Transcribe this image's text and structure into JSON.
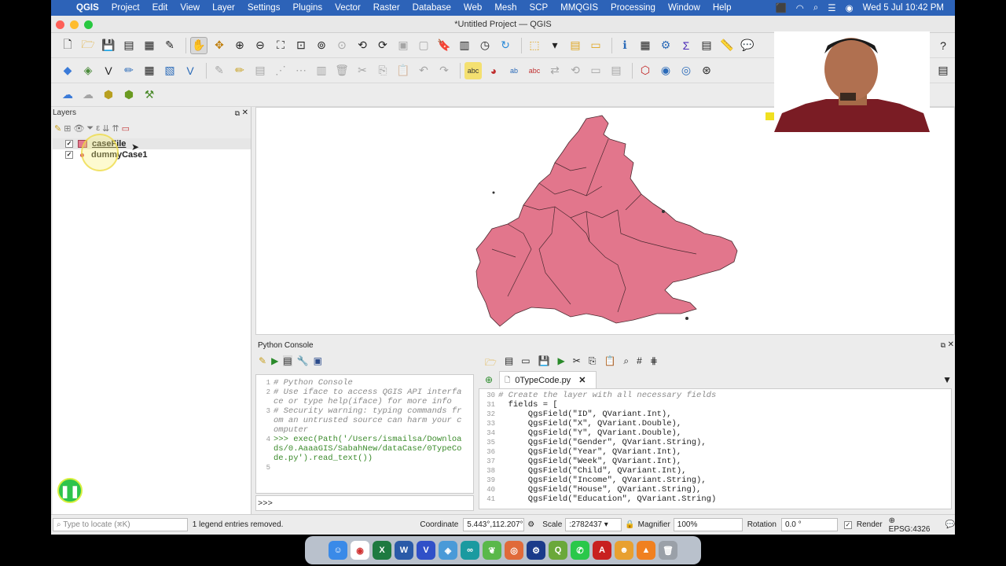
{
  "menubar": {
    "apple": "",
    "app": "QGIS",
    "items": [
      "Project",
      "Edit",
      "View",
      "Layer",
      "Settings",
      "Plugins",
      "Vector",
      "Raster",
      "Database",
      "Web",
      "Mesh",
      "SCP",
      "MMQGIS",
      "Processing",
      "Window",
      "Help"
    ],
    "clock": "Wed 5 Jul  10:42 PM"
  },
  "window": {
    "title": "*Untitled Project — QGIS"
  },
  "layers": {
    "title": "Layers",
    "items": [
      {
        "name": "caseFile",
        "checked": "✓",
        "color": "#e4788e"
      },
      {
        "name": "dummyCase1",
        "checked": "✓",
        "color": "#d0405a"
      }
    ]
  },
  "python": {
    "title": "Python Console",
    "console_lines": [
      {
        "n": "1",
        "t": "# Python Console",
        "cls": "cm"
      },
      {
        "n": "2",
        "t": "# Use iface to access QGIS API interfa",
        "cls": "cm"
      },
      {
        "n": "",
        "t": "ce or type help(iface) for more info",
        "cls": "cm"
      },
      {
        "n": "3",
        "t": "# Security warning: typing commands fr",
        "cls": "cm"
      },
      {
        "n": "",
        "t": "om an untrusted source can harm your c",
        "cls": "cm"
      },
      {
        "n": "",
        "t": "omputer",
        "cls": "cm"
      },
      {
        "n": "4",
        "t": ">>> exec(Path('/Users/ismailsa/Downloa",
        "cls": "st"
      },
      {
        "n": "",
        "t": "ds/0.AaaaGIS/SabahNew/dataCase/0TypeCo",
        "cls": "st"
      },
      {
        "n": "",
        "t": "de.py').read_text())",
        "cls": "st"
      },
      {
        "n": "5",
        "t": "",
        "cls": ""
      }
    ],
    "prompt": ">>>",
    "editor_tab": "0TypeCode.py",
    "editor_lines": [
      {
        "n": "30",
        "t": "# Create the layer with all necessary fields",
        "cls": "cm"
      },
      {
        "n": "31",
        "t": "  fields = [",
        "cls": ""
      },
      {
        "n": "32",
        "t": "      QgsField(\"ID\", QVariant.Int),",
        "cls": ""
      },
      {
        "n": "33",
        "t": "      QgsField(\"X\", QVariant.Double),",
        "cls": ""
      },
      {
        "n": "34",
        "t": "      QgsField(\"Y\", QVariant.Double),",
        "cls": ""
      },
      {
        "n": "35",
        "t": "      QgsField(\"Gender\", QVariant.String),",
        "cls": ""
      },
      {
        "n": "36",
        "t": "      QgsField(\"Year\", QVariant.Int),",
        "cls": ""
      },
      {
        "n": "37",
        "t": "      QgsField(\"Week\", QVariant.Int),",
        "cls": ""
      },
      {
        "n": "38",
        "t": "      QgsField(\"Child\", QVariant.Int),",
        "cls": ""
      },
      {
        "n": "39",
        "t": "      QgsField(\"Income\", QVariant.String),",
        "cls": ""
      },
      {
        "n": "40",
        "t": "      QgsField(\"House\", QVariant.String),",
        "cls": ""
      },
      {
        "n": "41",
        "t": "      QgsField(\"Education\", QVariant.String)",
        "cls": ""
      }
    ]
  },
  "status": {
    "locate_placeholder": "Type to locate (⌘K)",
    "message": "1 legend entries removed.",
    "coordinate_label": "Coordinate",
    "coordinate": "5.443°,112.207°",
    "scale_label": "Scale",
    "scale": ":2782437",
    "magnifier_label": "Magnifier",
    "magnifier": "100%",
    "rotation_label": "Rotation",
    "rotation": "0.0 °",
    "render_label": "Render",
    "crs": "EPSG:4326"
  },
  "dock": [
    "Finder",
    "Chrome",
    "Excel",
    "Word",
    "Vectr",
    "Maps",
    "Arduino",
    "Leaf",
    "Camera",
    "Steam",
    "QGIS",
    "WhatsApp",
    "Acrobat",
    "Game",
    "VLC",
    "Trash"
  ]
}
